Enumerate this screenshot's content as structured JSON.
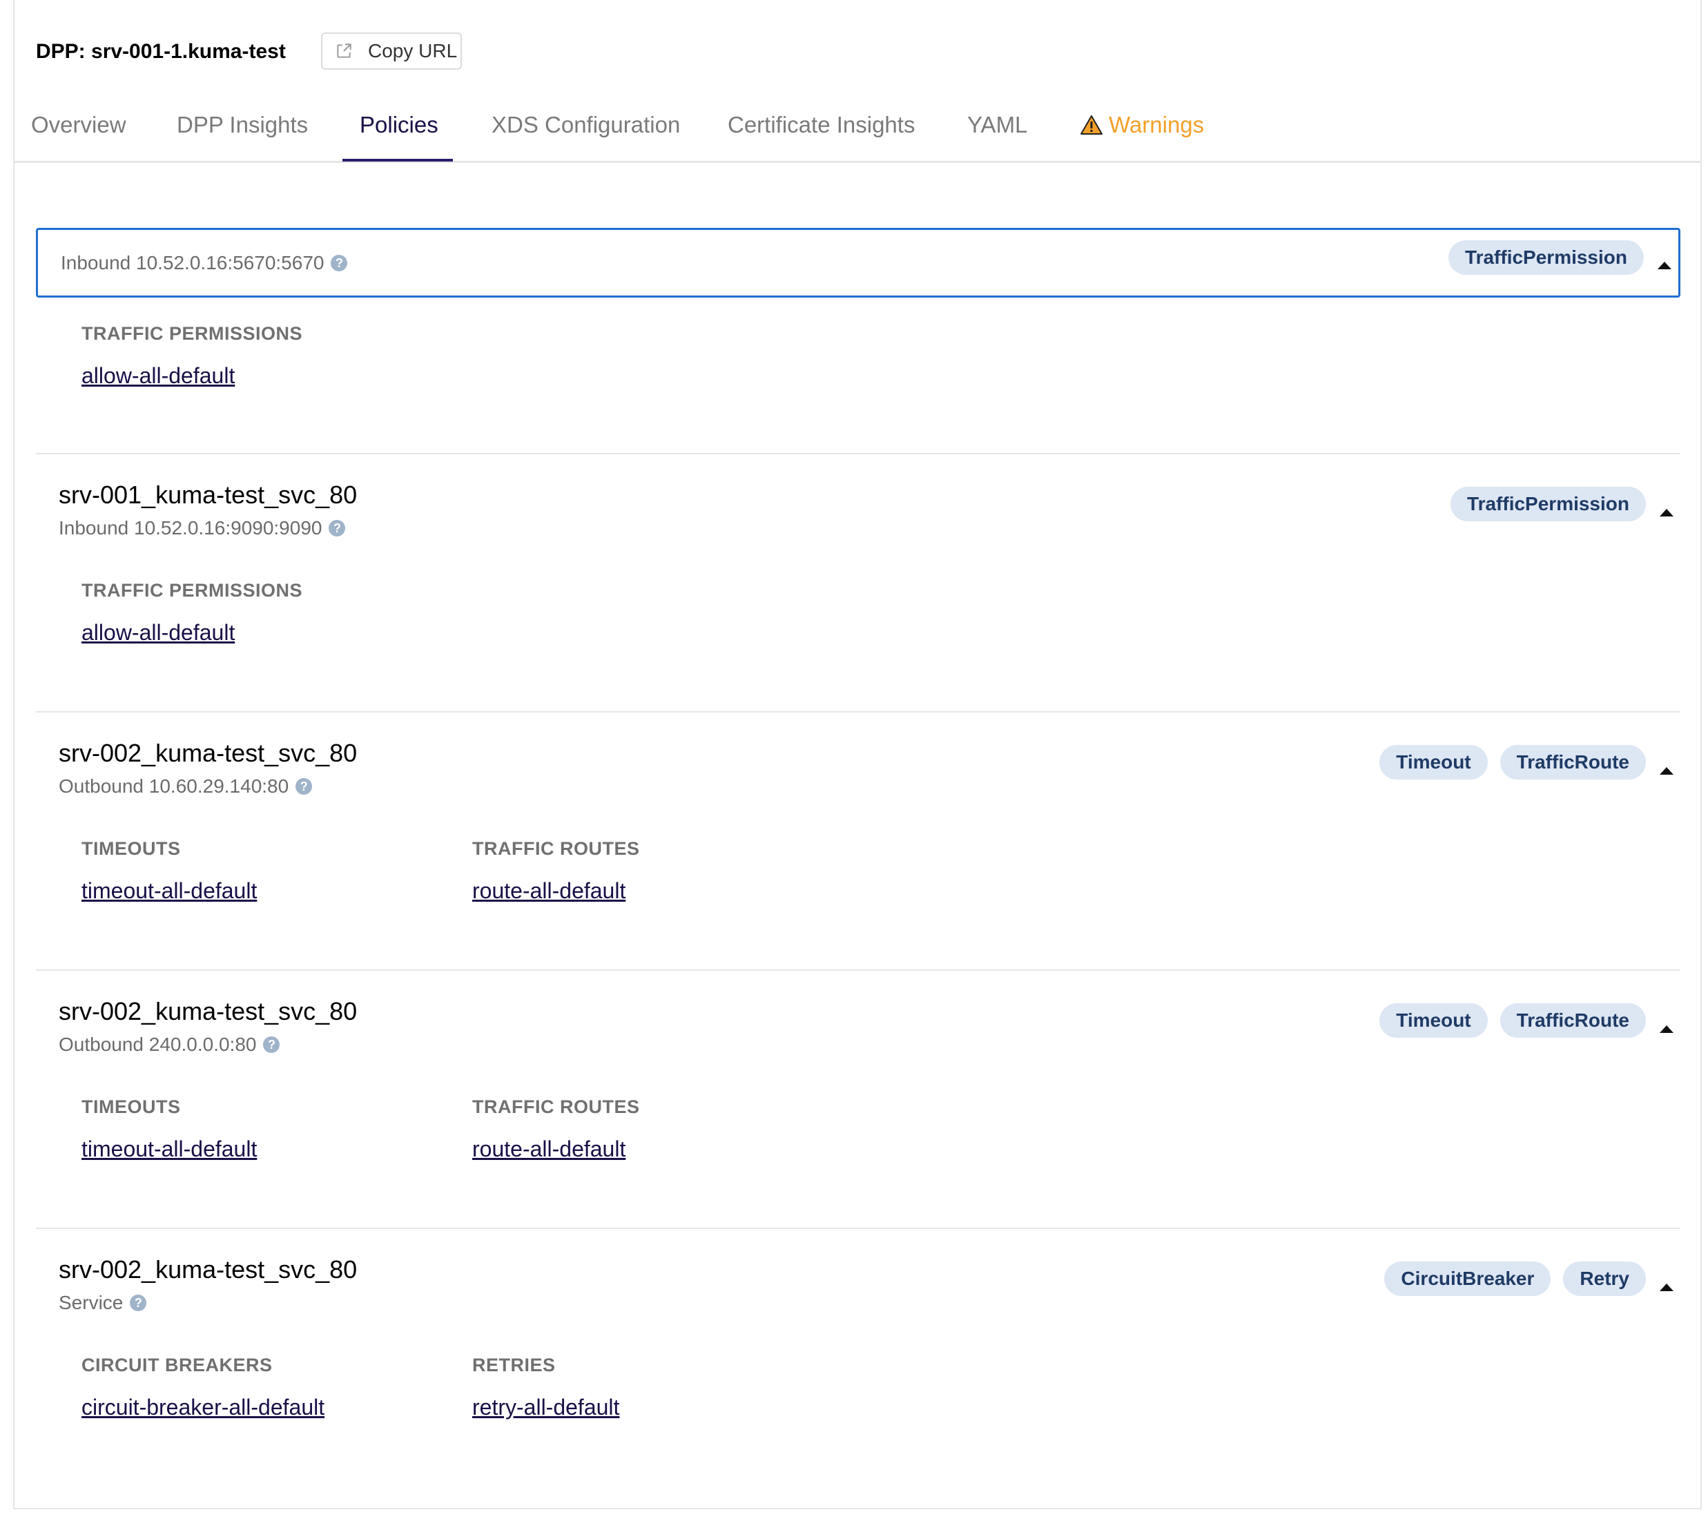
{
  "header": {
    "title": "DPP: srv-001-1.kuma-test",
    "copy_url_label": "Copy URL",
    "copy_icon": "external-link-icon"
  },
  "tabs": [
    {
      "label": "Overview"
    },
    {
      "label": "DPP Insights"
    },
    {
      "label": "Policies",
      "active": true
    },
    {
      "label": "XDS Configuration"
    },
    {
      "label": "Certificate Insights"
    },
    {
      "label": "YAML"
    },
    {
      "label": "Warnings",
      "icon": "warning-icon"
    }
  ],
  "colors": {
    "accent": "#1f6fd1",
    "warning": "#f3a02a",
    "badge_bg": "#dde6f3",
    "link": "#1a0f47"
  },
  "sections": [
    {
      "name": "",
      "subtitle": "Inbound 10.52.0.16:5670:5670",
      "badges": [
        "TrafficPermission"
      ],
      "groups": [
        {
          "heading": "TRAFFIC PERMISSIONS",
          "links": [
            "allow-all-default"
          ]
        }
      ]
    },
    {
      "name": "srv-001_kuma-test_svc_80",
      "subtitle": "Inbound 10.52.0.16:9090:9090",
      "badges": [
        "TrafficPermission"
      ],
      "groups": [
        {
          "heading": "TRAFFIC PERMISSIONS",
          "links": [
            "allow-all-default"
          ]
        }
      ]
    },
    {
      "name": "srv-002_kuma-test_svc_80",
      "subtitle": "Outbound 10.60.29.140:80",
      "badges": [
        "Timeout",
        "TrafficRoute"
      ],
      "groups": [
        {
          "heading": "TIMEOUTS",
          "links": [
            "timeout-all-default"
          ]
        },
        {
          "heading": "TRAFFIC ROUTES",
          "links": [
            "route-all-default"
          ]
        }
      ]
    },
    {
      "name": "srv-002_kuma-test_svc_80",
      "subtitle": "Outbound 240.0.0.0:80",
      "badges": [
        "Timeout",
        "TrafficRoute"
      ],
      "groups": [
        {
          "heading": "TIMEOUTS",
          "links": [
            "timeout-all-default"
          ]
        },
        {
          "heading": "TRAFFIC ROUTES",
          "links": [
            "route-all-default"
          ]
        }
      ]
    },
    {
      "name": "srv-002_kuma-test_svc_80",
      "subtitle": "Service",
      "badges": [
        "CircuitBreaker",
        "Retry"
      ],
      "groups": [
        {
          "heading": "CIRCUIT BREAKERS",
          "links": [
            "circuit-breaker-all-default"
          ]
        },
        {
          "heading": "RETRIES",
          "links": [
            "retry-all-default"
          ]
        }
      ]
    }
  ]
}
